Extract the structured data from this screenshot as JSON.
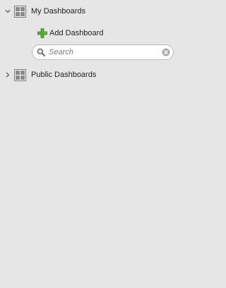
{
  "colors": {
    "panel_background": "#e6e6e6",
    "text": "#222222",
    "placeholder": "#7a7a7a",
    "add_icon_green": "#5aa832",
    "grid_icon": "#777777",
    "search_border": "#b9b9b9"
  },
  "tree": {
    "my_dashboards": {
      "label": "My Dashboards",
      "expanded": true,
      "toggle_icon": "chevron-down-icon",
      "icon": "dashboard-grid-icon"
    },
    "add_dashboard": {
      "label": "Add Dashboard",
      "icon": "add-plus-icon"
    },
    "search": {
      "value": "",
      "placeholder": "Search",
      "icon": "search-icon",
      "clear_icon": "clear-icon"
    },
    "public_dashboards": {
      "label": "Public Dashboards",
      "expanded": false,
      "toggle_icon": "chevron-right-icon",
      "icon": "dashboard-grid-icon"
    }
  }
}
